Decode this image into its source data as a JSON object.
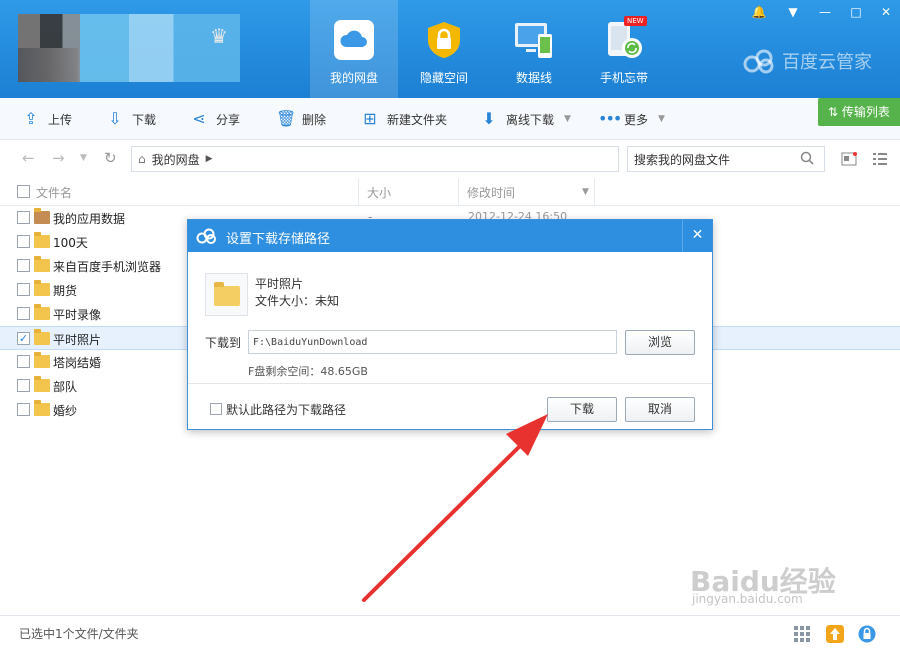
{
  "header": {
    "nav": [
      {
        "label": "我的网盘",
        "icon": "cloud-icon"
      },
      {
        "label": "隐藏空间",
        "icon": "lock-icon"
      },
      {
        "label": "数据线",
        "icon": "monitor-phone-icon"
      },
      {
        "label": "手机忘带",
        "icon": "phone-sync-icon",
        "badge": "NEW"
      }
    ],
    "brand": "百度云管家"
  },
  "toolbar": {
    "upload": "上传",
    "download": "下载",
    "share": "分享",
    "delete": "删除",
    "new_folder": "新建文件夹",
    "offline_download": "离线下载",
    "more": "更多",
    "transfer_list": "传输列表"
  },
  "address": {
    "breadcrumb": "我的网盘",
    "search_placeholder": "搜索我的网盘文件"
  },
  "table": {
    "headers": {
      "name": "文件名",
      "size": "大小",
      "modified": "修改时间"
    },
    "rows": [
      {
        "name": "我的应用数据",
        "size": "-",
        "modified": "2012-12-24 16:50",
        "checked": false,
        "type": "app"
      },
      {
        "name": "100天",
        "checked": false
      },
      {
        "name": "来自百度手机浏览器",
        "checked": false
      },
      {
        "name": "期货",
        "checked": false
      },
      {
        "name": "平时录像",
        "checked": false
      },
      {
        "name": "平时照片",
        "checked": true
      },
      {
        "name": "塔岗结婚",
        "checked": false
      },
      {
        "name": "部队",
        "checked": false
      },
      {
        "name": "婚纱",
        "checked": false
      }
    ]
  },
  "status": {
    "text": "已选中1个文件/文件夹"
  },
  "dialog": {
    "title": "设置下载存储路径",
    "file_name": "平时照片",
    "file_size": "文件大小：未知",
    "download_to_label": "下载到",
    "path_value": "F:\\BaiduYunDownload",
    "browse": "浏览",
    "free_space": "F盘剩余空间：48.65GB",
    "default_path_label": "默认此路径为下载路径",
    "download_button": "下载",
    "cancel_button": "取消"
  },
  "watermark": {
    "main": "Baidu经验",
    "sub": "jingyan.baidu.com"
  },
  "colors": {
    "header_blue": "#1c7fd3",
    "accent_blue": "#2e8ee0",
    "transfer_green": "#56b34b",
    "arrow_red": "#e8322f"
  }
}
